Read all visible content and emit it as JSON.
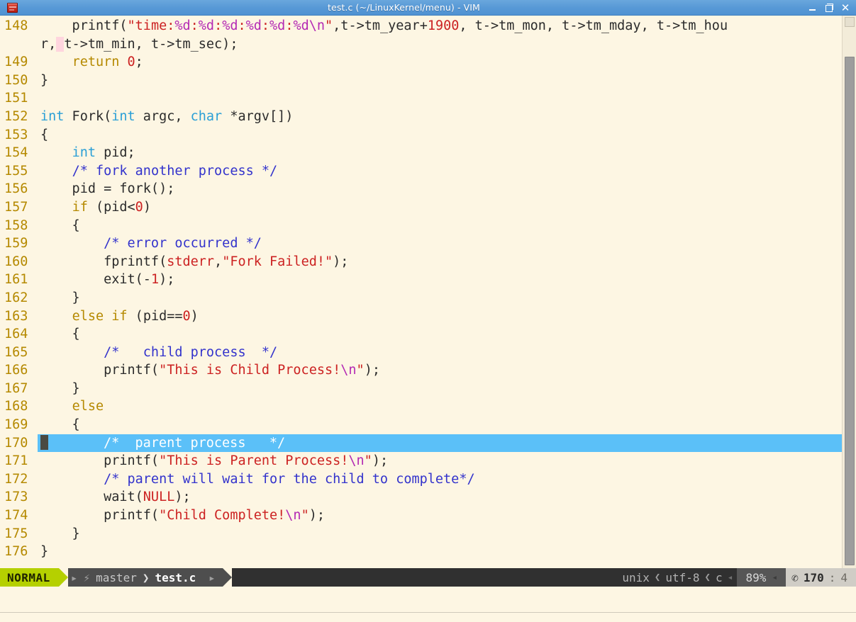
{
  "window": {
    "title": "test.c (~/LinuxKernel/menu) - VIM",
    "app_icon": "vim-icon",
    "controls": {
      "minimize": "minimize-icon",
      "maximize": "maximize-icon",
      "close": "✕"
    }
  },
  "editor": {
    "filetype": "c",
    "cursor_line": 170,
    "cursor_col": 4,
    "lines": [
      {
        "number": "148",
        "tokens": [
          {
            "t": "    printf(",
            "c": "plain"
          },
          {
            "t": "\"time:",
            "c": "str"
          },
          {
            "t": "%d",
            "c": "fmt"
          },
          {
            "t": ":",
            "c": "str"
          },
          {
            "t": "%d",
            "c": "fmt"
          },
          {
            "t": ":",
            "c": "str"
          },
          {
            "t": "%d",
            "c": "fmt"
          },
          {
            "t": ":",
            "c": "str"
          },
          {
            "t": "%d",
            "c": "fmt"
          },
          {
            "t": ":",
            "c": "str"
          },
          {
            "t": "%d",
            "c": "fmt"
          },
          {
            "t": ":",
            "c": "str"
          },
          {
            "t": "%d",
            "c": "fmt"
          },
          {
            "t": "\\n",
            "c": "esc"
          },
          {
            "t": "\"",
            "c": "str"
          },
          {
            "t": ",t->tm_year+",
            "c": "plain"
          },
          {
            "t": "1900",
            "c": "num"
          },
          {
            "t": ", t->tm_mon, t->tm_mday, t->tm_hou",
            "c": "plain"
          }
        ]
      },
      {
        "number": "",
        "tokens": [
          {
            "t": "r,",
            "c": "plain"
          },
          {
            "t": " ",
            "c": "sel"
          },
          {
            "t": "t->tm_min, t->tm_sec);",
            "c": "plain"
          }
        ]
      },
      {
        "number": "149",
        "tokens": [
          {
            "t": "    ",
            "c": "plain"
          },
          {
            "t": "return",
            "c": "kw"
          },
          {
            "t": " ",
            "c": "plain"
          },
          {
            "t": "0",
            "c": "num"
          },
          {
            "t": ";",
            "c": "plain"
          }
        ]
      },
      {
        "number": "150",
        "tokens": [
          {
            "t": "}",
            "c": "plain"
          }
        ]
      },
      {
        "number": "151",
        "tokens": [
          {
            "t": "",
            "c": "plain"
          }
        ]
      },
      {
        "number": "152",
        "tokens": [
          {
            "t": "int",
            "c": "type"
          },
          {
            "t": " Fork(",
            "c": "plain"
          },
          {
            "t": "int",
            "c": "type"
          },
          {
            "t": " argc, ",
            "c": "plain"
          },
          {
            "t": "char",
            "c": "type"
          },
          {
            "t": " *argv[])",
            "c": "plain"
          }
        ]
      },
      {
        "number": "153",
        "tokens": [
          {
            "t": "{",
            "c": "plain"
          }
        ]
      },
      {
        "number": "154",
        "tokens": [
          {
            "t": "    ",
            "c": "plain"
          },
          {
            "t": "int",
            "c": "type"
          },
          {
            "t": " pid;",
            "c": "plain"
          }
        ]
      },
      {
        "number": "155",
        "tokens": [
          {
            "t": "    ",
            "c": "plain"
          },
          {
            "t": "/* fork another process */",
            "c": "cmt"
          }
        ]
      },
      {
        "number": "156",
        "tokens": [
          {
            "t": "    pid = fork();",
            "c": "plain"
          }
        ]
      },
      {
        "number": "157",
        "tokens": [
          {
            "t": "    ",
            "c": "plain"
          },
          {
            "t": "if",
            "c": "kw"
          },
          {
            "t": " (pid<",
            "c": "plain"
          },
          {
            "t": "0",
            "c": "num"
          },
          {
            "t": ")",
            "c": "plain"
          }
        ]
      },
      {
        "number": "158",
        "tokens": [
          {
            "t": "    {",
            "c": "plain"
          }
        ]
      },
      {
        "number": "159",
        "tokens": [
          {
            "t": "        ",
            "c": "plain"
          },
          {
            "t": "/* error occurred */",
            "c": "cmt"
          }
        ]
      },
      {
        "number": "160",
        "tokens": [
          {
            "t": "        fprintf(",
            "c": "plain"
          },
          {
            "t": "stderr",
            "c": "const"
          },
          {
            "t": ",",
            "c": "plain"
          },
          {
            "t": "\"Fork Failed!\"",
            "c": "str"
          },
          {
            "t": ");",
            "c": "plain"
          }
        ]
      },
      {
        "number": "161",
        "tokens": [
          {
            "t": "        exit(-",
            "c": "plain"
          },
          {
            "t": "1",
            "c": "num"
          },
          {
            "t": ");",
            "c": "plain"
          }
        ]
      },
      {
        "number": "162",
        "tokens": [
          {
            "t": "    }",
            "c": "plain"
          }
        ]
      },
      {
        "number": "163",
        "tokens": [
          {
            "t": "    ",
            "c": "plain"
          },
          {
            "t": "else",
            "c": "kw"
          },
          {
            "t": " ",
            "c": "plain"
          },
          {
            "t": "if",
            "c": "kw"
          },
          {
            "t": " (pid==",
            "c": "plain"
          },
          {
            "t": "0",
            "c": "num"
          },
          {
            "t": ")",
            "c": "plain"
          }
        ]
      },
      {
        "number": "164",
        "tokens": [
          {
            "t": "    {",
            "c": "plain"
          }
        ]
      },
      {
        "number": "165",
        "tokens": [
          {
            "t": "        ",
            "c": "plain"
          },
          {
            "t": "/*   child process  */",
            "c": "cmt"
          }
        ]
      },
      {
        "number": "166",
        "tokens": [
          {
            "t": "        printf(",
            "c": "plain"
          },
          {
            "t": "\"This is Child Process!",
            "c": "str"
          },
          {
            "t": "\\n",
            "c": "esc"
          },
          {
            "t": "\"",
            "c": "str"
          },
          {
            "t": ");",
            "c": "plain"
          }
        ]
      },
      {
        "number": "167",
        "tokens": [
          {
            "t": "    }",
            "c": "plain"
          }
        ]
      },
      {
        "number": "168",
        "tokens": [
          {
            "t": "    ",
            "c": "plain"
          },
          {
            "t": "else",
            "c": "kw"
          }
        ]
      },
      {
        "number": "169",
        "tokens": [
          {
            "t": "    {",
            "c": "plain"
          }
        ]
      },
      {
        "number": "170",
        "cursorline": true,
        "tokens": [
          {
            "t": "cursor",
            "c": "cursor"
          },
          {
            "t": "       ",
            "c": "plain"
          },
          {
            "t": "/*  parent process   */",
            "c": "cmt-hl"
          }
        ]
      },
      {
        "number": "171",
        "tokens": [
          {
            "t": "        printf(",
            "c": "plain"
          },
          {
            "t": "\"This is Parent Process!",
            "c": "str"
          },
          {
            "t": "\\n",
            "c": "esc"
          },
          {
            "t": "\"",
            "c": "str"
          },
          {
            "t": ");",
            "c": "plain"
          }
        ]
      },
      {
        "number": "172",
        "tokens": [
          {
            "t": "        ",
            "c": "plain"
          },
          {
            "t": "/* parent will wait for the child to complete*/",
            "c": "cmt"
          }
        ]
      },
      {
        "number": "173",
        "tokens": [
          {
            "t": "        wait(",
            "c": "plain"
          },
          {
            "t": "NULL",
            "c": "const"
          },
          {
            "t": ");",
            "c": "plain"
          }
        ]
      },
      {
        "number": "174",
        "tokens": [
          {
            "t": "        printf(",
            "c": "plain"
          },
          {
            "t": "\"Child Complete!",
            "c": "str"
          },
          {
            "t": "\\n",
            "c": "esc"
          },
          {
            "t": "\"",
            "c": "str"
          },
          {
            "t": ");",
            "c": "plain"
          }
        ]
      },
      {
        "number": "175",
        "tokens": [
          {
            "t": "    }",
            "c": "plain"
          }
        ]
      },
      {
        "number": "176",
        "tokens": [
          {
            "t": "}",
            "c": "plain"
          }
        ]
      }
    ]
  },
  "statusline": {
    "mode": "NORMAL",
    "branch_glyph": "⚡",
    "branch": "master",
    "sep_glyph": "❯",
    "filename": "test.c",
    "fileformat": "unix",
    "encoding": "utf-8",
    "filetype": "c",
    "percent": "89%",
    "line_glyph": "✆",
    "line": "170",
    "colon": ":",
    "column": "4",
    "sep_left": "❮"
  },
  "cmdline": {
    "text": ""
  },
  "colors": {
    "titlebar": "#5899d6",
    "background": "#fdf6e3",
    "cursorline": "#5bc0f8",
    "lineno": "#b58900",
    "string": "#cc2222",
    "comment": "#3333cc",
    "type": "#2a9fd6",
    "keyword": "#b58900",
    "mode_badge": "#b5d000"
  }
}
